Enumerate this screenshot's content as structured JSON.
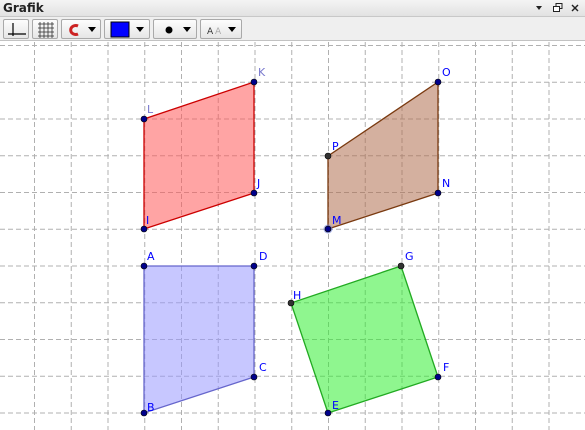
{
  "window": {
    "title": "Grafik"
  },
  "toolbar": {
    "buttons": [
      {
        "name": "axes-toggle-button",
        "icon": "axes-icon"
      },
      {
        "name": "grid-toggle-button",
        "icon": "grid-icon"
      },
      {
        "name": "point-capturing-button",
        "icon": "magnet-icon"
      },
      {
        "name": "color-button",
        "icon": "color-swatch",
        "color": "#0000ff"
      },
      {
        "name": "point-style-button",
        "icon": "point-style-icon"
      },
      {
        "name": "label-style-button",
        "icon": "label-style-icon",
        "text": "A A"
      }
    ]
  },
  "colors": {
    "grid": "#b0b0b0",
    "label_blue": "#0000ff",
    "point_blue": "#00008b",
    "point_dark": "#333333",
    "red_fill": "#ff5a5a",
    "red_stroke": "#cc0000",
    "brown_fill": "#b07050",
    "brown_stroke": "#7a3a10",
    "purple_fill": "#9999ff",
    "purple_stroke": "#6666cc",
    "green_fill": "#33ee33",
    "green_stroke": "#22aa22"
  },
  "polygons": [
    {
      "name": "polygon-IJKL",
      "vertices": [
        "I",
        "J",
        "K",
        "L"
      ],
      "fill": "#ff5a5a",
      "stroke": "#cc0000"
    },
    {
      "name": "polygon-MNOP",
      "vertices": [
        "M",
        "N",
        "O",
        "P"
      ],
      "fill": "#b07050",
      "stroke": "#7a3a10"
    },
    {
      "name": "polygon-ABCD",
      "vertices": [
        "A",
        "B",
        "C",
        "D"
      ],
      "fill": "#9999ff",
      "stroke": "#6666cc"
    },
    {
      "name": "polygon-EFGH",
      "vertices": [
        "E",
        "F",
        "G",
        "H"
      ],
      "fill": "#33ee33",
      "stroke": "#22aa22"
    }
  ],
  "points": {
    "A": {
      "label": "A"
    },
    "B": {
      "label": "B"
    },
    "C": {
      "label": "C"
    },
    "D": {
      "label": "D"
    },
    "E": {
      "label": "E"
    },
    "F": {
      "label": "F"
    },
    "G": {
      "label": "G"
    },
    "H": {
      "label": "H"
    },
    "I": {
      "label": "I"
    },
    "J": {
      "label": "J"
    },
    "K": {
      "label": "K"
    },
    "L": {
      "label": "L"
    },
    "M": {
      "label": "M"
    },
    "N": {
      "label": "N"
    },
    "O": {
      "label": "O"
    },
    "P": {
      "label": "P"
    }
  }
}
